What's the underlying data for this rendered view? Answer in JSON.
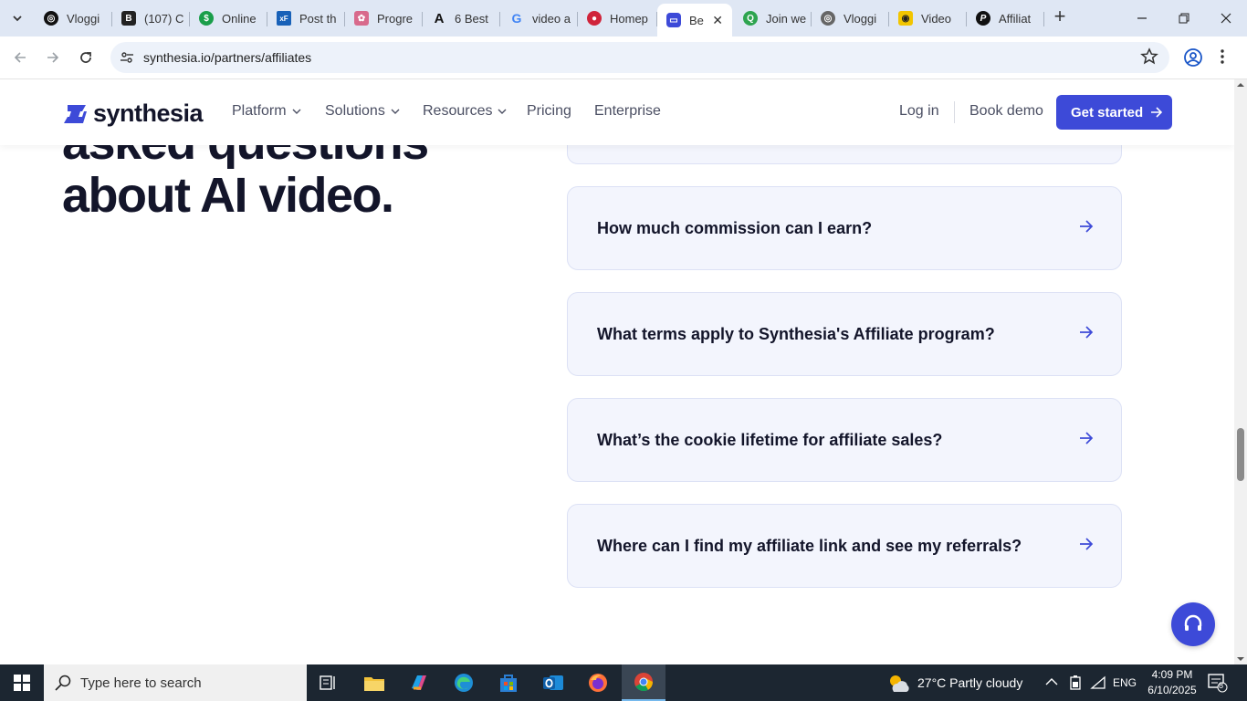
{
  "browser": {
    "tabs": [
      {
        "title": "Vloggi",
        "fav_color": "#111111",
        "fav_glyph": "◎"
      },
      {
        "title": "(107) C",
        "fav_color": "#222222",
        "fav_glyph": "B"
      },
      {
        "title": "Online",
        "fav_color": "#1a9e4a",
        "fav_glyph": "$"
      },
      {
        "title": "Post th",
        "fav_color": "#1861b8",
        "fav_glyph": "xF"
      },
      {
        "title": "Progre",
        "fav_color": "#d86a8c",
        "fav_glyph": "✿"
      },
      {
        "title": "6 Best",
        "fav_color": "#ffffff",
        "fav_glyph": "A"
      },
      {
        "title": "video a",
        "fav_color": "#ffffff",
        "fav_glyph": "G"
      },
      {
        "title": "Homep",
        "fav_color": "#d0243b",
        "fav_glyph": "●"
      },
      {
        "title": "Be",
        "fav_color": "#3d4ad8",
        "fav_glyph": "▭"
      },
      {
        "title": "Join we",
        "fav_color": "#2ea44f",
        "fav_glyph": "Q"
      },
      {
        "title": "Vloggi",
        "fav_color": "#666666",
        "fav_glyph": "◎"
      },
      {
        "title": "Video",
        "fav_color": "#f2c500",
        "fav_glyph": "◉"
      },
      {
        "title": "Affiliat",
        "fav_color": "#111111",
        "fav_glyph": "P"
      }
    ],
    "active_tab_index": 8,
    "url": "synthesia.io/partners/affiliates"
  },
  "header": {
    "brand": "synthesia",
    "nav": [
      {
        "label": "Platform",
        "has_menu": true
      },
      {
        "label": "Solutions",
        "has_menu": true
      },
      {
        "label": "Resources",
        "has_menu": true
      },
      {
        "label": "Pricing",
        "has_menu": false
      },
      {
        "label": "Enterprise",
        "has_menu": false
      }
    ],
    "login": "Log in",
    "book_demo": "Book demo",
    "get_started": "Get started"
  },
  "hero": {
    "line1": "asked questions",
    "line2": "about AI video."
  },
  "faq": [
    {
      "question": "How much commission can I earn?"
    },
    {
      "question": "What terms apply to Synthesia's Affiliate program?"
    },
    {
      "question": "What’s the cookie lifetime for affiliate sales?"
    },
    {
      "question": "Where can I find my affiliate link and see my referrals?"
    }
  ],
  "taskbar": {
    "search_placeholder": "Type here to search",
    "weather": "27°C  Partly cloudy",
    "language": "ENG",
    "time": "4:09 PM",
    "date": "6/10/2025",
    "notification_count": "8"
  },
  "colors": {
    "brand_blue": "#3d4ad8",
    "heading": "#13152a",
    "card_bg": "#f3f5fd"
  }
}
